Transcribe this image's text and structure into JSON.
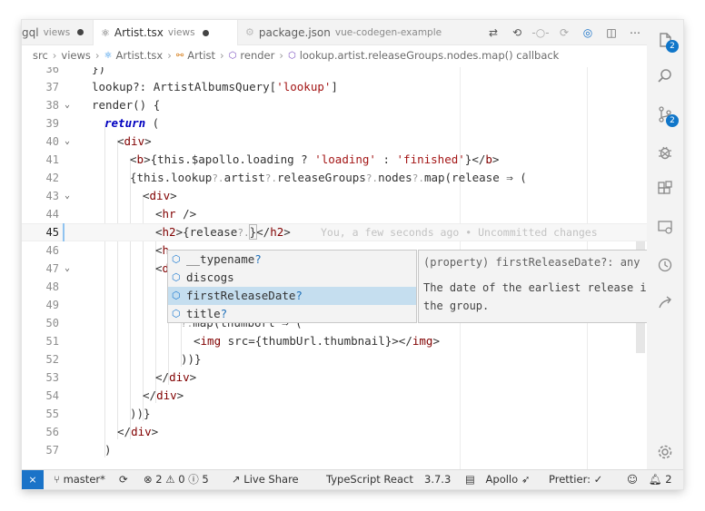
{
  "tabs": [
    {
      "name": "gql",
      "dir": "views",
      "dirty": true
    },
    {
      "name": "Artist.tsx",
      "dir": "views",
      "dirty": true,
      "active": true
    },
    {
      "name": "package.json",
      "dir": "vue-codegen-example",
      "dirty": false
    }
  ],
  "tab_actions": [
    "compare-icon",
    "back-icon",
    "commit-icon",
    "forward-icon",
    "gitlens-icon",
    "split-icon",
    "more-icon"
  ],
  "breadcrumb": [
    "src",
    "views",
    "Artist.tsx",
    "Artist",
    "render",
    "lookup.artist.releaseGroups.nodes.map() callback"
  ],
  "lines": {
    "l36": "36",
    "l37": "37",
    "l38": "38",
    "l39": "39",
    "l40": "40",
    "l41": "41",
    "l42": "42",
    "l43": "43",
    "l44": "44",
    "l45": "45",
    "l46": "46",
    "l47": "47",
    "l48": "48",
    "l49": "49",
    "l50": "50",
    "l51": "51",
    "l52": "52",
    "l53": "53",
    "l54": "54",
    "l55": "55",
    "l56": "56",
    "l57": "57"
  },
  "code": {
    "c36": "})",
    "c37a": "lookup?: ArtistAlbumsQuery[",
    "c37s": "'lookup'",
    "c37b": "]",
    "c38": "render() {",
    "c39a": "return",
    "c39b": " (",
    "c41a": "{this.$apollo.loading ? ",
    "c41s1": "'loading'",
    "c41m": " : ",
    "c41s2": "'finished'",
    "c41b": "}",
    "c42a": "{this.lookup",
    "c42b": "artist",
    "c42c": "releaseGroups",
    "c42d": "nodes",
    "c42e": "map(release ⇒ (",
    "c45a": "{release",
    "c45b": "}",
    "c45blame": "You, a few seconds ago • Uncommitted changes",
    "c50b": "map(thumbUrl ⇒ (",
    "c51": "src={thumbUrl.thumbnail}>",
    "c52": "))}",
    "c55": "))}",
    "c57": ")",
    "q": "?.",
    "tag_div": "div",
    "tag_b": "b",
    "tag_hr": "hr",
    "tag_h2": "h2",
    "tag_h": "h",
    "tag_d": "d",
    "tag_img": "img"
  },
  "suggest": {
    "items": [
      {
        "label": "__typename",
        "optional": "?"
      },
      {
        "label": "discogs",
        "optional": ""
      },
      {
        "label": "firstReleaseDate",
        "optional": "?",
        "selected": true
      },
      {
        "label": "title",
        "optional": "?"
      }
    ]
  },
  "detail": {
    "signature": "(property) firstReleaseDate?: any",
    "doc": "The date of the earliest release in the group.",
    "close": "×"
  },
  "activity": {
    "explorer_badge": "2",
    "scm_badge": "2"
  },
  "status": {
    "branch": "master*",
    "errors": "2",
    "warnings": "0",
    "info": "5",
    "live_share": "Live Share",
    "language": "TypeScript React",
    "ts_version": "3.7.3",
    "apollo": "Apollo",
    "prettier": "Prettier: ✓",
    "notifications": "2"
  },
  "colors": {
    "accent": "#1a73c8",
    "selection": "#c5deef",
    "keyword": "#0000c0",
    "tag": "#800000",
    "string": "#a31515"
  }
}
